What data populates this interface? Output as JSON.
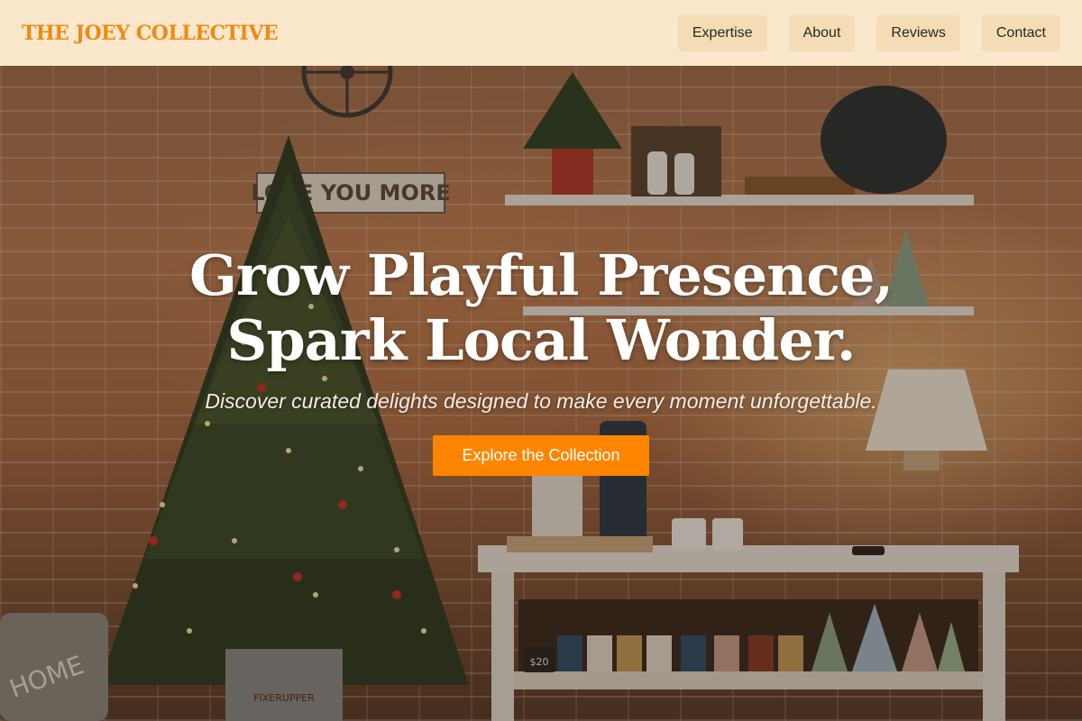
{
  "header": {
    "brand": "THE JOEY COLLECTIVE",
    "nav": [
      {
        "label": "Expertise"
      },
      {
        "label": "About"
      },
      {
        "label": "Reviews"
      },
      {
        "label": "Contact"
      }
    ]
  },
  "hero": {
    "headline_line1": "Grow Playful Presence,",
    "headline_line2": "Spark Local Wonder.",
    "subheadline": "Discover curated delights designed to make every moment unforgettable.",
    "cta_label": "Explore the Collection",
    "photo_text": {
      "sign": "LOVE YOU MORE",
      "pillow": "HOME",
      "price_tag": "$20",
      "bucket": "FIXERUPPER"
    }
  },
  "colors": {
    "accent": "#ff8500",
    "brand": "#f08a12",
    "header_bg": "#fbe8cc",
    "nav_button_bg": "#f3dcb6"
  }
}
